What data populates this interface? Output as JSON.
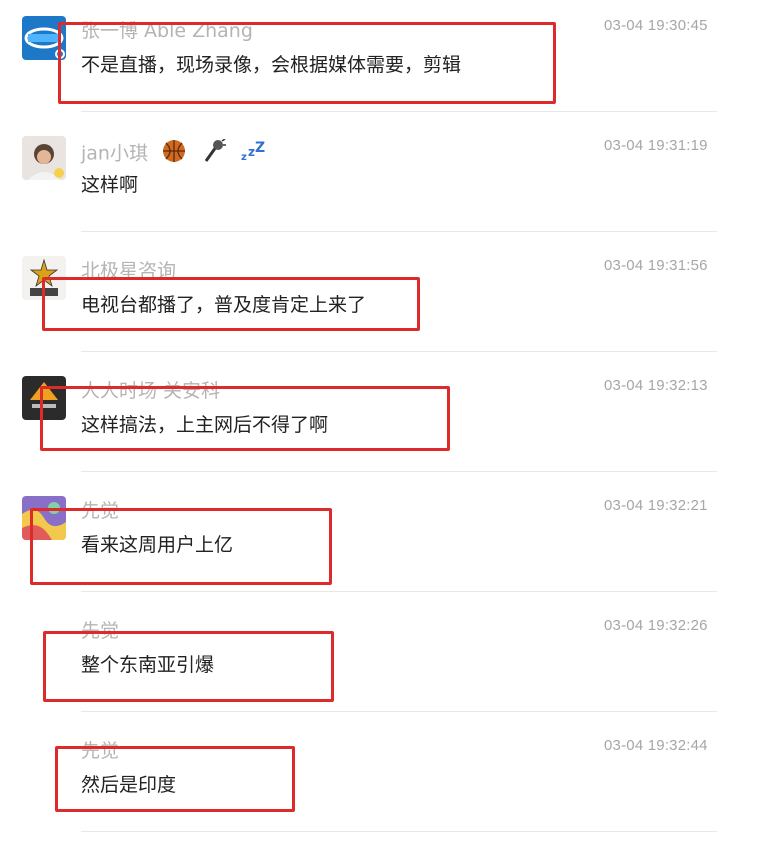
{
  "highlight_color": "#dd2a2a",
  "messages": [
    {
      "sender": "张一博 Able Zhang",
      "time": "03-04 19:30:45",
      "text": "不是直播，现场录像，会根据媒体需要，剪辑",
      "avatar": "blue-logo-avatar"
    },
    {
      "sender": "jan小琪",
      "time": "03-04 19:31:19",
      "text": "这样啊",
      "avatar": "person-photo-avatar",
      "name_emoji": [
        "basketball-icon",
        "microphone-icon",
        "zzz-icon"
      ]
    },
    {
      "sender": "北极星咨询",
      "time": "03-04 19:31:56",
      "text": "电视台都播了，普及度肯定上来了",
      "avatar": "polaris-logo-avatar"
    },
    {
      "sender": "人人时场 关安科",
      "time": "03-04 19:32:13",
      "text": "这样搞法，上主网后不得了啊",
      "avatar": "dark-logo-avatar"
    },
    {
      "sender": "先觉",
      "time": "03-04 19:32:21",
      "text": "看来这周用户上亿",
      "avatar": "colorful-avatar"
    },
    {
      "sender": "先觉",
      "time": "03-04 19:32:26",
      "text": "整个东南亚引爆"
    },
    {
      "sender": "先觉",
      "time": "03-04 19:32:44",
      "text": "然后是印度"
    }
  ]
}
